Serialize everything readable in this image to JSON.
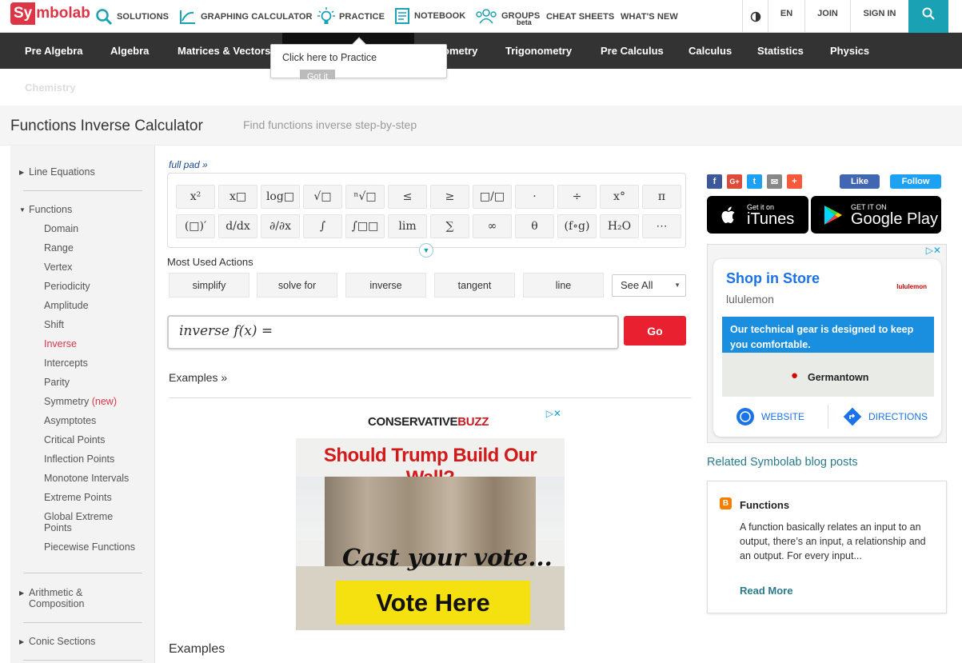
{
  "brand": {
    "logo_part1": "Sy",
    "logo_part2": "mbolab"
  },
  "topnav": {
    "solutions": "SOLUTIONS",
    "graphing": "GRAPHING CALCULATOR",
    "practice": "PRACTICE",
    "notebook": "NOTEBOOK",
    "groups": "GROUPS",
    "groups_badge": "beta",
    "cheat_sheets": "CHEAT SHEETS",
    "whats_new": "WHAT'S NEW",
    "language": "EN",
    "join": "JOIN",
    "sign_in": "SIGN IN"
  },
  "subjects": [
    "Pre Algebra",
    "Algebra",
    "Matrices & Vectors",
    "ometry",
    "Trigonometry",
    "Pre Calculus",
    "Calculus",
    "Statistics",
    "Physics",
    "Chemistry"
  ],
  "tooltip": {
    "text": "Click here to Practice",
    "button": "Got it"
  },
  "page": {
    "title": "Functions Inverse Calculator",
    "subtitle": "Find functions inverse step-by-step"
  },
  "sidebar": {
    "line_equations": "Line Equations",
    "functions": "Functions",
    "function_items": [
      "Domain",
      "Range",
      "Vertex",
      "Periodicity",
      "Amplitude",
      "Shift",
      "Inverse",
      "Intercepts",
      "Parity",
      "Symmetry",
      "Asymptotes",
      "Critical Points",
      "Inflection Points",
      "Monotone Intervals",
      "Extreme Points",
      "Global Extreme Points",
      "Piecewise Functions"
    ],
    "new_tag": "(new)",
    "arithmetic_line1": "Arithmetic &",
    "arithmetic_line2": "Composition",
    "conic_sections": "Conic Sections"
  },
  "main": {
    "full_pad": "full pad »",
    "keypad_row1": [
      "x²",
      "x□",
      "log□",
      "√□",
      "ⁿ√□",
      "≤",
      "≥",
      "□/□",
      "·",
      "÷",
      "x°",
      "π"
    ],
    "keypad_row2": [
      "(□)′",
      "d/dx",
      "∂/∂x",
      "∫",
      "∫□□",
      "lim",
      "∑",
      "∞",
      "θ",
      "(f∘g)",
      "H₂O",
      "⋯"
    ],
    "most_used_title": "Most Used Actions",
    "actions": [
      "simplify",
      "solve for",
      "inverse",
      "tangent",
      "line"
    ],
    "see_all": "See All",
    "input_value": "inverse f(x) =",
    "go": "Go",
    "examples_link": "Examples »",
    "examples_heading": "Examples"
  },
  "ad_left": {
    "brand_a": "CONSERVATIVE",
    "brand_b": "BUZZ",
    "headline": "Should Trump Build Our Wall?",
    "cast": "Cast your vote...",
    "cta": "Vote Here"
  },
  "right": {
    "fb_like": "Like",
    "tw_follow": "Follow",
    "itunes_small": "Get it on",
    "itunes_big": "iTunes",
    "gplay_small": "GET IT ON",
    "gplay_big": "Google Play",
    "ad": {
      "title": "Shop in Store",
      "brand": "lululemon",
      "brand_logo": "lululemon",
      "message": "Our technical gear is designed to keep you comfortable.",
      "location": "Germantown",
      "website": "WEBSITE",
      "directions": "DIRECTIONS"
    },
    "related_heading": "Related Symbolab blog posts",
    "blog": {
      "title": "Functions",
      "excerpt": "A function basically relates an input to an output, there’s an input, a relationship and an output. For every input...",
      "read_more": "Read More"
    }
  },
  "colors": {
    "brand_red": "#dc3545",
    "teal": "#1aa1b3",
    "go_red": "#e8202f",
    "nav_dark": "#333333"
  }
}
